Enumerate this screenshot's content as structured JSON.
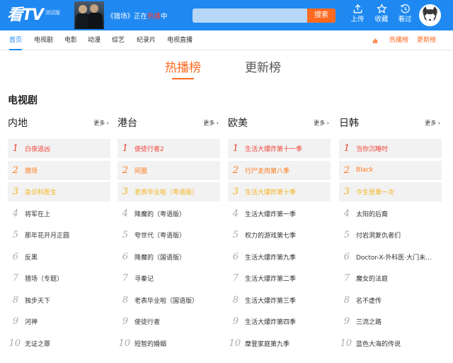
{
  "header": {
    "logo": "看TV",
    "logo_sub": "测试版",
    "banner": {
      "prefix": "《猎场》正在",
      "highlight": "热播",
      "suffix": "中"
    },
    "search": {
      "placeholder": "",
      "button": "搜索"
    },
    "buttons": [
      {
        "label": "上传",
        "icon": "upload-icon"
      },
      {
        "label": "收藏",
        "icon": "star-icon"
      },
      {
        "label": "看过",
        "icon": "history-icon"
      }
    ]
  },
  "nav": {
    "items": [
      "首页",
      "电视剧",
      "电影",
      "动漫",
      "综艺",
      "纪录片",
      "电视直播"
    ],
    "active": "首页",
    "right": [
      "热播榜",
      "更新榜"
    ]
  },
  "tabs": [
    "热播榜",
    "更新榜"
  ],
  "active_tab": "热播榜",
  "section_title": "电视剧",
  "more_label": "更多 ›",
  "columns": [
    {
      "title": "内地",
      "items": [
        "白夜追凶",
        "猎场",
        "急诊科医生",
        "将军在上",
        "那年花开月正圆",
        "反黑",
        "猎场（专题）",
        "独步天下",
        "河神",
        "无证之罪"
      ]
    },
    {
      "title": "港台",
      "items": [
        "使徒行者2",
        "同盟",
        "老表毕业啦（粤语版）",
        "降魔的（粤语版）",
        "夸世代（粤语版）",
        "降魔的（国语版）",
        "寻秦记",
        "老表毕业啦（国语版）",
        "使徒行者",
        "短暂的婚姻"
      ]
    },
    {
      "title": "欧美",
      "items": [
        "生活大爆炸第十一季",
        "行尸走肉第八季",
        "生活大爆炸第十季",
        "生活大爆炸第一季",
        "权力的游戏第七季",
        "生活大爆炸第九季",
        "生活大爆炸第二季",
        "生活大爆炸第三季",
        "生活大爆炸第四季",
        "摩登家庭第九季"
      ]
    },
    {
      "title": "日韩",
      "items": [
        "当你沉睡时",
        "Black",
        "今生是第一次",
        "太阳的后裔",
        "付岩洞复仇者们",
        "Doctor-X-外科医·大门未知子",
        "魔女的法庭",
        "名不虚传",
        "三流之路",
        "蓝色大海的传说"
      ]
    }
  ],
  "colors": {
    "brand_blue": "#1f89f1",
    "accent_orange": "#ff6a21",
    "rank1": "#f04438",
    "rank2": "#ff7a1a",
    "rank3": "#f3b41e"
  }
}
